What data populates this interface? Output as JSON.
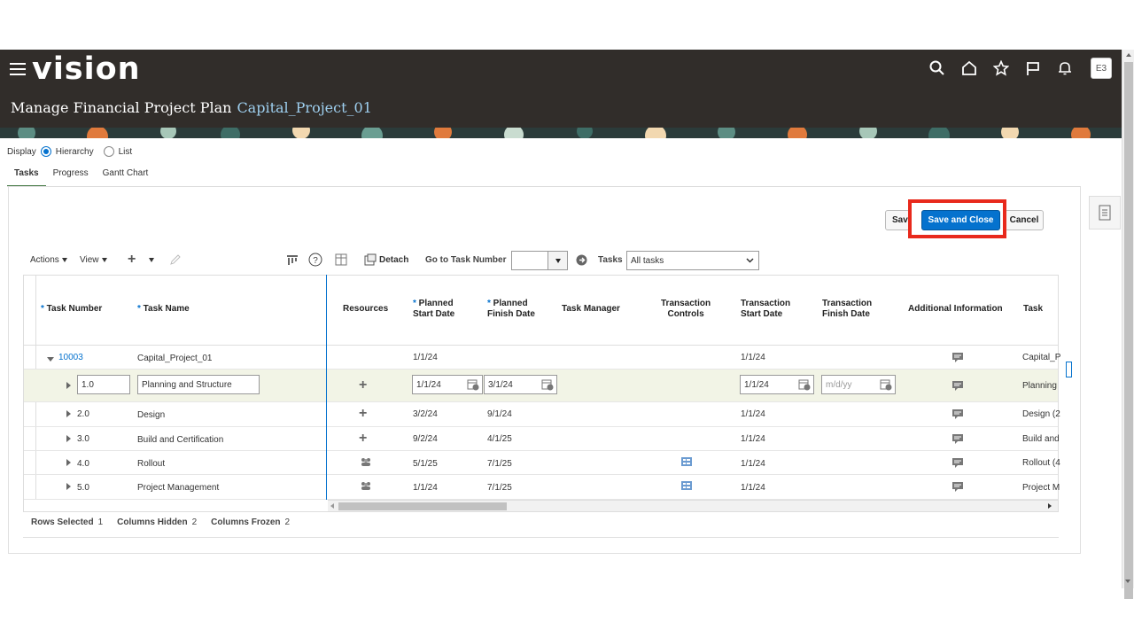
{
  "app": {
    "logo": "vision",
    "page_title": "Manage Financial Project Plan",
    "project_name": "Capital_Project_01",
    "avatar_initials": "E3",
    "header_icons": [
      "search-icon",
      "home-icon",
      "star-icon",
      "flag-icon",
      "bell-icon"
    ]
  },
  "display": {
    "label": "Display",
    "options": [
      "Hierarchy",
      "List"
    ],
    "selected": "Hierarchy"
  },
  "tabs": [
    "Tasks",
    "Progress",
    "Gantt Chart"
  ],
  "buttons": {
    "save": "Sav",
    "save_close": "Save and Close",
    "cancel": "Cancel"
  },
  "toolbar": {
    "actions": "Actions",
    "view": "View",
    "detach": "Detach",
    "goto_label": "Go to Task Number",
    "tasks_label": "Tasks",
    "tasks_filter": "All tasks"
  },
  "columns": {
    "task_number": "Task Number",
    "task_name": "Task Name",
    "resources": "Resources",
    "planned_start_1": "Planned",
    "planned_start_2": "Start Date",
    "planned_finish_1": "Planned",
    "planned_finish_2": "Finish Date",
    "task_manager": "Task Manager",
    "trans_controls_1": "Transaction",
    "trans_controls_2": "Controls",
    "trans_start_1": "Transaction",
    "trans_start_2": "Start Date",
    "trans_finish_1": "Transaction",
    "trans_finish_2": "Finish Date",
    "additional_info": "Additional Information",
    "task": "Task"
  },
  "rows": [
    {
      "number": "10003",
      "name": "Capital_Project_01",
      "planned_start": "1/1/24",
      "planned_finish": "",
      "trans_start": "1/1/24",
      "task": "Capital_P"
    },
    {
      "number": "1.0",
      "name": "Planning and Structure",
      "planned_start": "1/1/24",
      "planned_finish": "3/1/24",
      "trans_start": "1/1/24",
      "trans_finish_placeholder": "m/d/yy",
      "task": "Planning"
    },
    {
      "number": "2.0",
      "name": "Design",
      "planned_start": "3/2/24",
      "planned_finish": "9/1/24",
      "trans_start": "1/1/24",
      "task": "Design (2"
    },
    {
      "number": "3.0",
      "name": "Build and Certification",
      "planned_start": "9/2/24",
      "planned_finish": "4/1/25",
      "trans_start": "1/1/24",
      "task": "Build and"
    },
    {
      "number": "4.0",
      "name": "Rollout",
      "planned_start": "5/1/25",
      "planned_finish": "7/1/25",
      "trans_start": "1/1/24",
      "task": "Rollout (4"
    },
    {
      "number": "5.0",
      "name": "Project Management",
      "planned_start": "1/1/24",
      "planned_finish": "7/1/25",
      "trans_start": "1/1/24",
      "task": "Project M"
    }
  ],
  "footer": {
    "rows_selected_label": "Rows Selected",
    "rows_selected": "1",
    "columns_hidden_label": "Columns Hidden",
    "columns_hidden": "2",
    "columns_frozen_label": "Columns Frozen",
    "columns_frozen": "2"
  },
  "colors": {
    "header_bg": "#312d2a",
    "primary": "#0572ce",
    "highlight": "#e8291c"
  }
}
